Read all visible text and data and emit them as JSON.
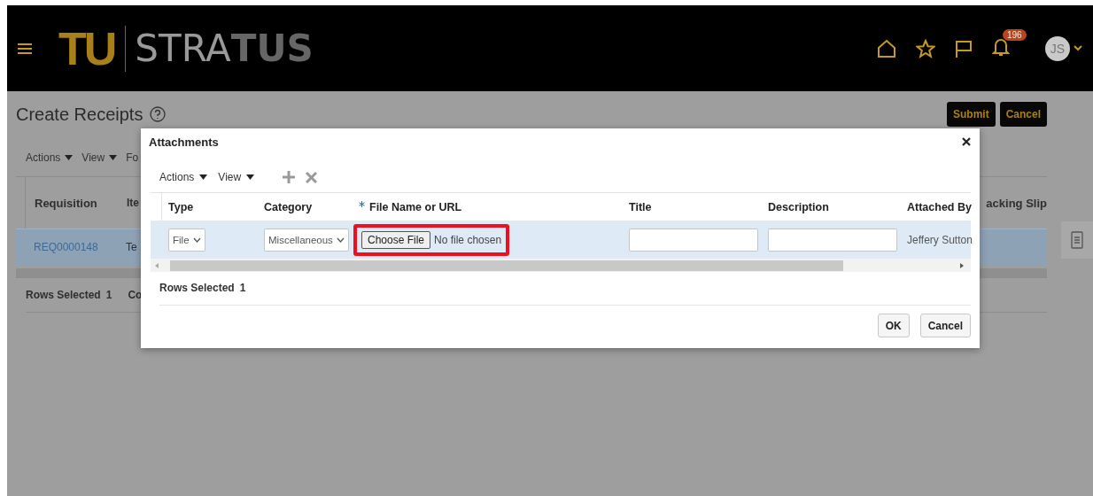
{
  "header": {
    "logo_mark": "TU",
    "logo_word": "STRA**TUS**",
    "notification_count": "196",
    "avatar_initials": "JS"
  },
  "page": {
    "title": "Create Receipts",
    "buttons": [
      "Submit",
      "Cancel"
    ],
    "toolbar": [
      "Actions",
      "View",
      "Fo"
    ],
    "table": {
      "columns": [
        "Requisition",
        "Ite",
        "acking Slip"
      ],
      "rows": [
        {
          "cells": [
            "REQ0000148",
            "Te"
          ],
          "selected": true
        }
      ]
    },
    "footer": [
      "Rows Selected",
      "1",
      "Co"
    ]
  },
  "dialog": {
    "title": "Attachments",
    "toolbar": [
      "Actions",
      "View"
    ],
    "columns": [
      {
        "label": "Type",
        "required": false
      },
      {
        "label": "Category",
        "required": false
      },
      {
        "label": "File Name or URL",
        "required": true
      },
      {
        "label": "Title",
        "required": false
      },
      {
        "label": "Description",
        "required": false
      },
      {
        "label": "Attached By",
        "required": false
      }
    ],
    "rows": [
      {
        "selected": true,
        "type": "File",
        "category": "Miscellaneous",
        "file_button": "Choose File",
        "file_status": "No file chosen",
        "file_highlighted": true,
        "attached_by": "Jeffery Sutton"
      }
    ],
    "rows_selected_label": "Rows Selected",
    "rows_selected_count": "1",
    "buttons": [
      "OK",
      "Cancel"
    ]
  }
}
